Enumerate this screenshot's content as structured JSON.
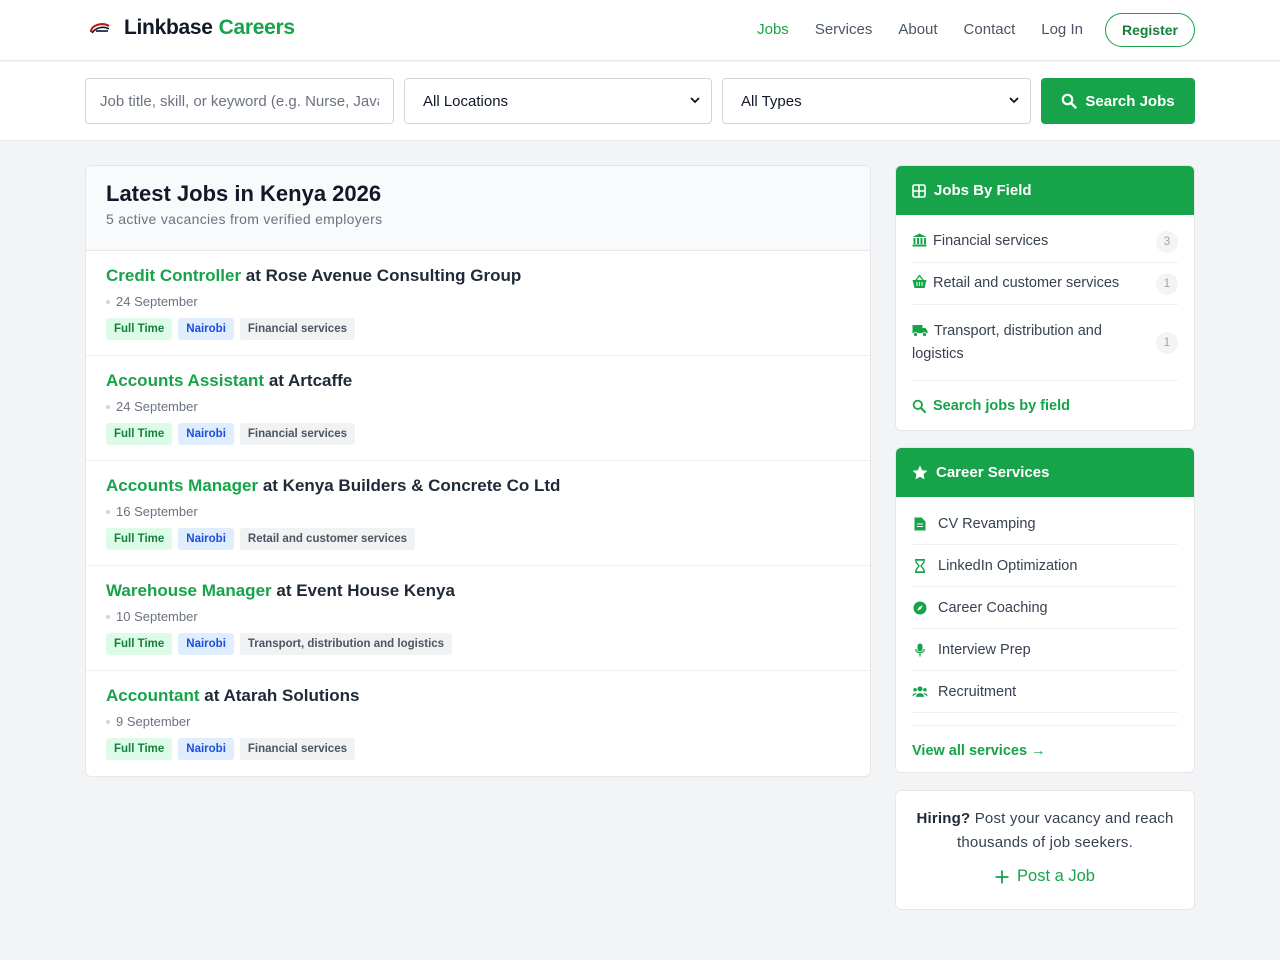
{
  "header": {
    "brand_name": "Linkbase",
    "brand_highlight": "Careers",
    "nav": [
      "Jobs",
      "Services",
      "About",
      "Contact",
      "Log In"
    ],
    "register_label": "Register",
    "accent_color": "#16a34a"
  },
  "search": {
    "keyword_placeholder": "Job title, skill, or keyword (e.g. Nurse, Java)",
    "location_selected": "All Locations",
    "type_selected": "All Types",
    "button_label": "Search Jobs"
  },
  "main": {
    "title": "Latest Jobs in Kenya 2026",
    "subtitle": "5 active vacancies from verified employers",
    "jobs": [
      {
        "title": "Credit Controller",
        "company": "at Rose Avenue Consulting Group",
        "date": "24 September",
        "type": "Full Time",
        "location": "Nairobi",
        "field": "Financial services"
      },
      {
        "title": "Accounts Assistant",
        "company": "at Artcaffe",
        "date": "24 September",
        "type": "Full Time",
        "location": "Nairobi",
        "field": "Financial services"
      },
      {
        "title": "Accounts Manager",
        "company": "at Kenya Builders & Concrete Co Ltd",
        "date": "16 September",
        "type": "Full Time",
        "location": "Nairobi",
        "field": "Retail and customer services"
      },
      {
        "title": "Warehouse Manager",
        "company": "at Event House Kenya",
        "date": "10 September",
        "type": "Full Time",
        "location": "Nairobi",
        "field": "Transport, distribution and logistics"
      },
      {
        "title": "Accountant",
        "company": "at Atarah Solutions",
        "date": "9 September",
        "type": "Full Time",
        "location": "Nairobi",
        "field": "Financial services"
      }
    ]
  },
  "sidebar": {
    "fields_title": "Jobs By Field",
    "fields": [
      {
        "label": "Financial services",
        "count": "3",
        "icon": "bank-icon"
      },
      {
        "label": "Retail and customer services",
        "count": "1",
        "icon": "basket-icon"
      },
      {
        "label": "Transport, distribution and logistics",
        "count": "1",
        "icon": "truck-icon"
      }
    ],
    "fields_link": "Search jobs by field",
    "services_title": "Career Services",
    "services": [
      {
        "label": "CV Revamping",
        "icon": "document-icon"
      },
      {
        "label": "LinkedIn Optimization",
        "icon": "linkedin-icon"
      },
      {
        "label": "Career Coaching",
        "icon": "compass-icon"
      },
      {
        "label": "Interview Prep",
        "icon": "microphone-icon"
      },
      {
        "label": "Recruitment",
        "icon": "users-icon"
      }
    ],
    "services_link": "View all services →",
    "hire_bold": "Hiring?",
    "hire_text": " Post your vacancy and reach thousands of job seekers.",
    "post_label": "Post a Job"
  }
}
